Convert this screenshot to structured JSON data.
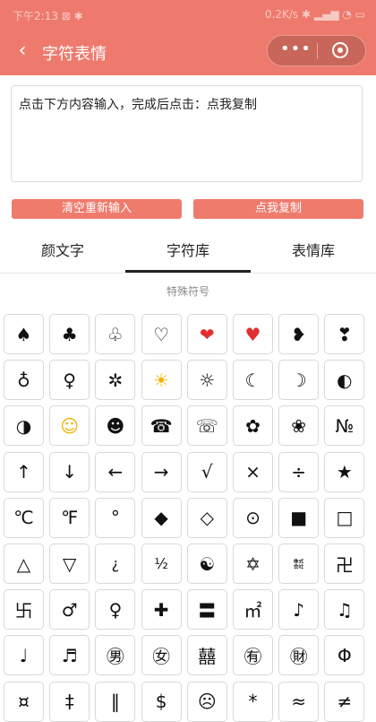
{
  "status_bar": {
    "left": "下午2:13 ⊠ ✱",
    "right": "0.2K/s ✱ ▂▄▆ ◔ ▭"
  },
  "nav": {
    "title": "字符表情",
    "back_icon": "chevron-left-icon",
    "menu_icon": "more-dots-icon",
    "close_icon": "target-icon"
  },
  "editor": {
    "text": "点击下方内容输入，完成后点击：点我复制"
  },
  "buttons": {
    "clear": "清空重新输入",
    "copy": "点我复制"
  },
  "tabs": [
    "颜文字",
    "字符库",
    "表情库"
  ],
  "section_title": "特殊符号",
  "symbols": [
    "♠",
    "♣",
    "♧",
    "♡",
    "❤",
    "♥",
    "❥",
    "❣",
    "♁",
    "♀",
    "✲",
    "☀",
    "☼",
    "☾",
    "☽",
    "◐",
    "◑",
    "☺",
    "☻",
    "☎",
    "☏",
    "✿",
    "❀",
    "№",
    "↑",
    "↓",
    "←",
    "→",
    "√",
    "×",
    "÷",
    "★",
    "℃",
    "℉",
    "°",
    "◆",
    "◇",
    "⊙",
    "■",
    "□",
    "△",
    "▽",
    "¿",
    "½",
    "☯",
    "✡",
    "㍿",
    "卍",
    "卐",
    "♂",
    "♀",
    "✚",
    "〓",
    "㎡",
    "♪",
    "♫",
    "♩",
    "♬",
    "㊚",
    "㊛",
    "囍",
    "㊒",
    "㊖",
    "Φ",
    "¤",
    "‡",
    "‖",
    "$",
    "☹",
    "*",
    "≈",
    "≠"
  ]
}
